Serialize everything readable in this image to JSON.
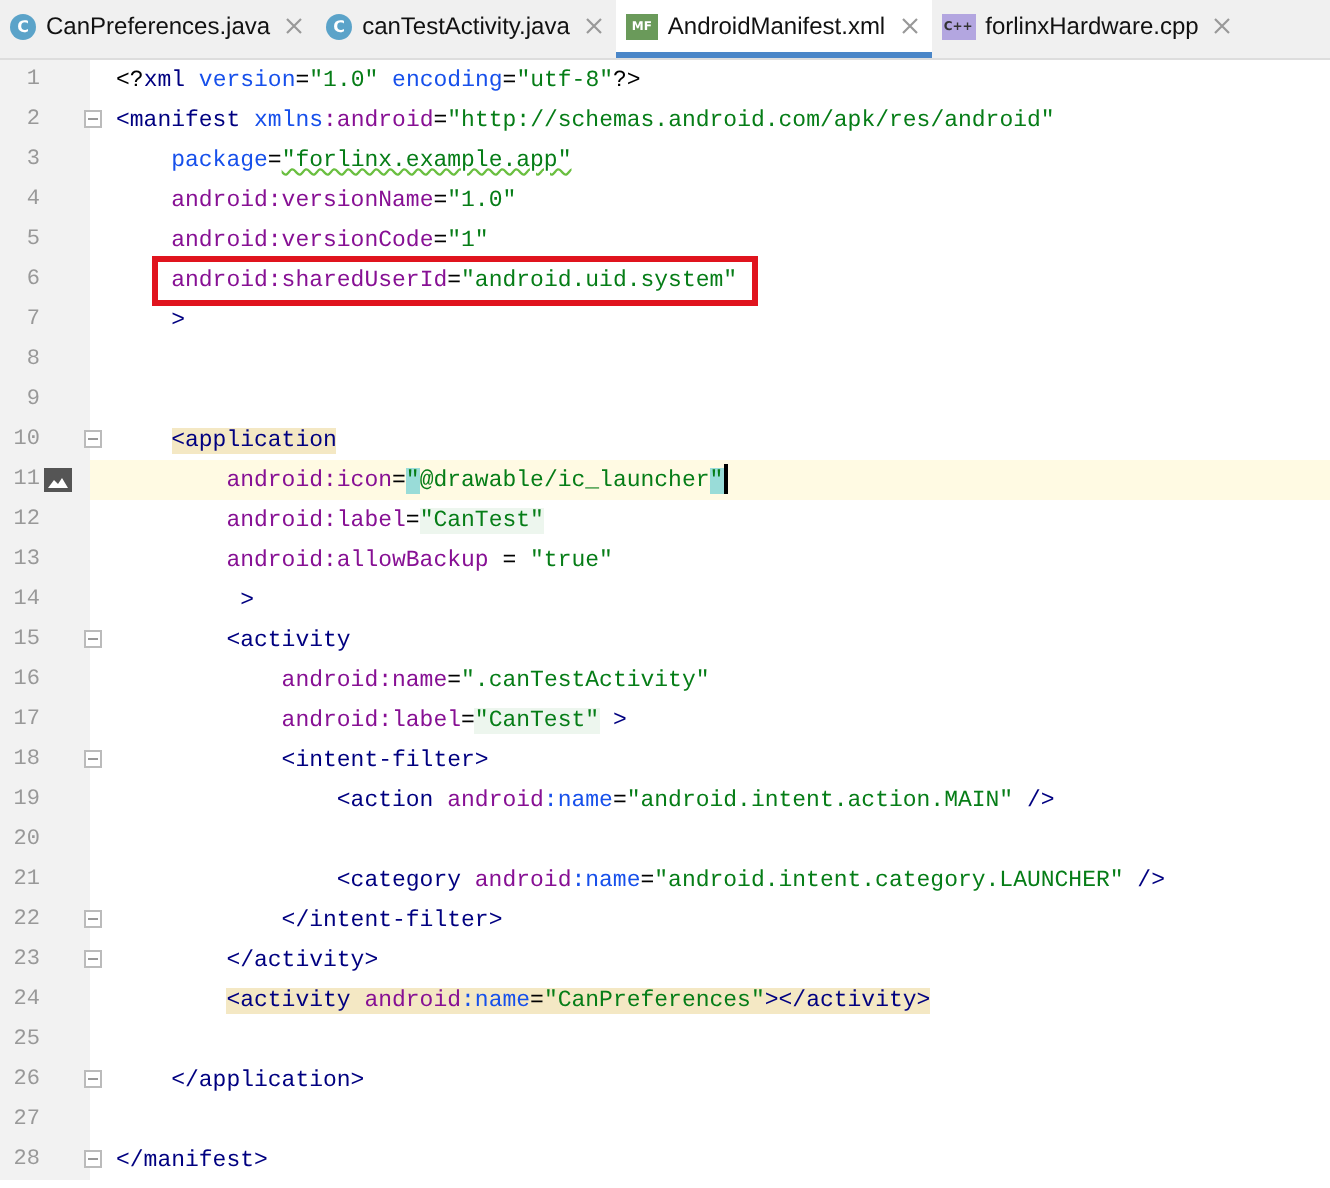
{
  "tabs": [
    {
      "label": "CanPreferences.java",
      "kind": "class",
      "icon_text": "C",
      "selected": false
    },
    {
      "label": "canTestActivity.java",
      "kind": "class",
      "icon_text": "C",
      "selected": false
    },
    {
      "label": "AndroidManifest.xml",
      "kind": "manifest",
      "icon_text": "MF",
      "selected": true
    },
    {
      "label": "forlinxHardware.cpp",
      "kind": "cpp",
      "icon_text": "C++",
      "selected": false
    }
  ],
  "lines": [
    {
      "number": "1",
      "tokens": [
        {
          "kind": "plain",
          "text": "<?"
        },
        {
          "kind": "tag",
          "text": "xml "
        },
        {
          "kind": "ns",
          "text": "version"
        },
        {
          "kind": "plain",
          "text": "="
        },
        {
          "kind": "value",
          "text": "\"1.0\""
        },
        {
          "kind": "ns",
          "text": " encoding"
        },
        {
          "kind": "plain",
          "text": "="
        },
        {
          "kind": "value",
          "text": "\"utf-8\""
        },
        {
          "kind": "plain",
          "text": "?>"
        }
      ]
    },
    {
      "number": "2",
      "fold": true,
      "tokens": [
        {
          "kind": "tag",
          "text": "<manifest "
        },
        {
          "kind": "ns",
          "text": "xmlns"
        },
        {
          "kind": "attr",
          "text": ":android"
        },
        {
          "kind": "plain",
          "text": "="
        },
        {
          "kind": "value",
          "text": "\"http://schemas.android.com/apk/res/android\""
        }
      ],
      "children": [
        {
          "number": "3",
          "tokens": [
            {
              "kind": "ns",
              "text": "package"
            },
            {
              "kind": "plain",
              "text": "="
            },
            {
              "kind": "value",
              "text": "\"forlinx.example.app\"",
              "spelling_warning": true
            }
          ]
        },
        {
          "number": "4",
          "tokens": [
            {
              "kind": "attr",
              "text": "android:versionName"
            },
            {
              "kind": "plain",
              "text": "="
            },
            {
              "kind": "value",
              "text": "\"1.0\""
            }
          ]
        },
        {
          "number": "5",
          "tokens": [
            {
              "kind": "attr",
              "text": "android:versionCode"
            },
            {
              "kind": "plain",
              "text": "="
            },
            {
              "kind": "value",
              "text": "\"1\""
            }
          ]
        },
        {
          "number": "6",
          "boxed": true,
          "tokens": [
            {
              "kind": "attr",
              "text": "android:sharedUserId"
            },
            {
              "kind": "plain",
              "text": "="
            },
            {
              "kind": "value",
              "text": "\"android.uid.system\""
            }
          ]
        },
        {
          "number": "7",
          "tokens": [
            {
              "kind": "tag",
              "text": ">"
            }
          ]
        },
        {
          "number": "8"
        },
        {
          "number": "9"
        },
        {
          "number": "10",
          "fold": true,
          "tokens": [
            {
              "kind": "tag",
              "text": "<application",
              "matched_tag": true
            }
          ],
          "children": [
            {
              "number": "11",
              "current": true,
              "gutter_icon": true,
              "tokens": [
                {
                  "kind": "attr",
                  "text": "android:icon"
                },
                {
                  "kind": "plain",
                  "text": "="
                },
                {
                  "kind": "value",
                  "text": "\"",
                  "matched_brace": true
                },
                {
                  "kind": "value",
                  "text": "@drawable/ic_launcher"
                },
                {
                  "kind": "value",
                  "text": "\"",
                  "matched_brace": true
                }
              ]
            },
            {
              "number": "12",
              "tokens": [
                {
                  "kind": "attr",
                  "text": "android:label"
                },
                {
                  "kind": "plain",
                  "text": "="
                },
                {
                  "kind": "value",
                  "text": "\"CanTest\"",
                  "usage_highlight": true
                }
              ]
            },
            {
              "number": "13",
              "tokens": [
                {
                  "kind": "attr",
                  "text": "android:allowBackup"
                },
                {
                  "kind": "plain",
                  "text": " = "
                },
                {
                  "kind": "value",
                  "text": "\"true\""
                }
              ]
            },
            {
              "number": "14",
              "tokens": [
                {
                  "kind": "tag",
                  "text": " >"
                }
              ]
            },
            {
              "number": "15",
              "fold": true,
              "tokens": [
                {
                  "kind": "tag",
                  "text": "<activity"
                }
              ],
              "children": [
                {
                  "number": "16",
                  "tokens": [
                    {
                      "kind": "attr",
                      "text": "android:name"
                    },
                    {
                      "kind": "plain",
                      "text": "="
                    },
                    {
                      "kind": "value",
                      "text": "\".canTestActivity\""
                    }
                  ]
                },
                {
                  "number": "17",
                  "tokens": [
                    {
                      "kind": "attr",
                      "text": "android:label"
                    },
                    {
                      "kind": "plain",
                      "text": "="
                    },
                    {
                      "kind": "value",
                      "text": "\"CanTest\"",
                      "usage_highlight": true
                    },
                    {
                      "kind": "tag",
                      "text": " >"
                    }
                  ]
                },
                {
                  "number": "18",
                  "fold": true,
                  "tokens": [
                    {
                      "kind": "tag",
                      "text": "<intent-filter>"
                    }
                  ],
                  "children": [
                    {
                      "number": "19",
                      "tokens": [
                        {
                          "kind": "tag",
                          "text": "<action "
                        },
                        {
                          "kind": "attr",
                          "text": "android"
                        },
                        {
                          "kind": "ns",
                          "text": ":name"
                        },
                        {
                          "kind": "plain",
                          "text": "="
                        },
                        {
                          "kind": "value",
                          "text": "\"android.intent.action.MAIN\""
                        },
                        {
                          "kind": "tag",
                          "text": " />"
                        }
                      ]
                    },
                    {
                      "number": "20"
                    },
                    {
                      "number": "21",
                      "tokens": [
                        {
                          "kind": "tag",
                          "text": "<category "
                        },
                        {
                          "kind": "attr",
                          "text": "android"
                        },
                        {
                          "kind": "ns",
                          "text": ":name"
                        },
                        {
                          "kind": "plain",
                          "text": "="
                        },
                        {
                          "kind": "value",
                          "text": "\"android.intent.category.LAUNCHER\""
                        },
                        {
                          "kind": "tag",
                          "text": " />"
                        }
                      ]
                    }
                  ]
                },
                {
                  "number": "22",
                  "fold": true,
                  "tokens": [
                    {
                      "kind": "tag",
                      "text": "</intent-filter>"
                    }
                  ]
                }
              ]
            },
            {
              "number": "23",
              "fold": true,
              "tokens": [
                {
                  "kind": "tag",
                  "text": "</activity>"
                }
              ]
            },
            {
              "number": "24",
              "tokens": [
                {
                  "kind": "tag",
                  "text": "<activity ",
                  "matched_tag": true
                },
                {
                  "kind": "attr",
                  "text": "android",
                  "matched_tag": true
                },
                {
                  "kind": "ns",
                  "text": ":name",
                  "matched_tag": true
                },
                {
                  "kind": "plain",
                  "text": "=",
                  "matched_tag": true
                },
                {
                  "kind": "value",
                  "text": "\"CanPreferences\"",
                  "matched_tag": true
                },
                {
                  "kind": "tag",
                  "text": "></activity>",
                  "matched_tag": true
                }
              ]
            },
            {
              "number": "25"
            }
          ]
        },
        {
          "number": "26",
          "fold": true,
          "tokens": [
            {
              "kind": "tag",
              "text": "</application>"
            }
          ]
        },
        {
          "number": "27"
        }
      ]
    },
    {
      "number": "28",
      "fold": true,
      "tokens": [
        {
          "kind": "tag",
          "text": "</manifest>"
        }
      ]
    }
  ]
}
